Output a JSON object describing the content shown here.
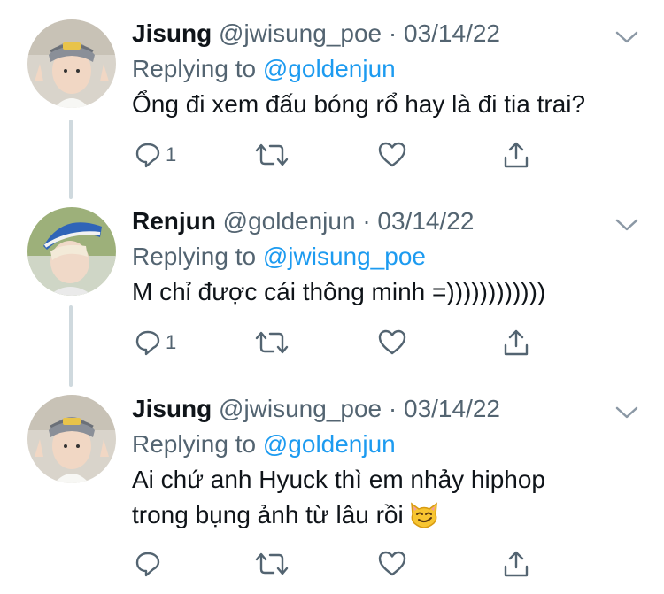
{
  "tweets": [
    {
      "name": "Jisung",
      "handle": "@jwisung_poe",
      "date": "· 03/14/22",
      "replying_label": "Replying to",
      "replying_to": "@goldenjun",
      "text": "Ổng đi xem đấu bóng rổ hay là đi tia trai?",
      "reply_count": "1"
    },
    {
      "name": "Renjun",
      "handle": "@goldenjun",
      "date": "· 03/14/22",
      "replying_label": "Replying to",
      "replying_to": "@jwisung_poe",
      "text": "M chỉ được cái thông minh =))))))))))))",
      "reply_count": "1"
    },
    {
      "name": "Jisung",
      "handle": "@jwisung_poe",
      "date": "· 03/14/22",
      "replying_label": "Replying to",
      "replying_to": "@goldenjun",
      "text_line1": "Ai chứ anh Hyuck thì em nhảy hiphop",
      "text_line2": "trong bụng ảnh từ lâu rồi",
      "emoji": "smirking-cat-face",
      "reply_count": ""
    }
  ],
  "icons": {
    "reply": "speech-bubble-icon",
    "retweet": "retweet-icon",
    "like": "heart-icon",
    "share": "share-icon",
    "more": "chevron-down-icon"
  },
  "colors": {
    "mention": "#1d9bf0",
    "secondary": "#536471",
    "thread_line": "#cfd9de"
  }
}
